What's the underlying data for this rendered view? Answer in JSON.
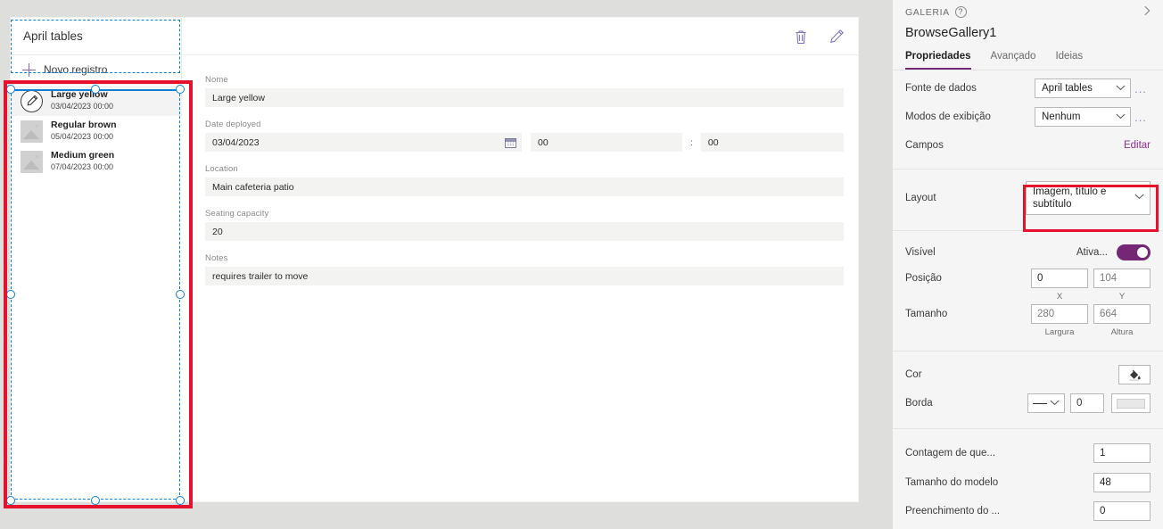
{
  "canvas": {
    "app_title": "April tables",
    "new_record_label": "Novo registro",
    "gallery_items": [
      {
        "title": "Large yellow",
        "subtitle": "03/04/2023 00:00",
        "thumb": "pencil-circle-icon",
        "selected": true
      },
      {
        "title": "Regular brown",
        "subtitle": "05/04/2023 00:00",
        "thumb": "image-placeholder-icon",
        "selected": false
      },
      {
        "title": "Medium green",
        "subtitle": "07/04/2023 00:00",
        "thumb": "image-placeholder-icon",
        "selected": false
      }
    ],
    "toolbar": {
      "delete_icon": "trash-icon",
      "edit_icon": "pencil-icon"
    },
    "form": {
      "fields": [
        {
          "label": "Nome",
          "value": "Large yellow"
        },
        {
          "label": "Location",
          "value": "Main cafeteria patio"
        },
        {
          "label": "Seating capacity",
          "value": "20"
        },
        {
          "label": "Notes",
          "value": "requires trailer to move"
        }
      ],
      "date_field": {
        "label": "Date deployed",
        "date": "03/04/2023",
        "calendar_icon": "calendar-icon",
        "hours": "00",
        "separator": ":",
        "minutes": "00"
      }
    }
  },
  "properties": {
    "kind": "GALERIA",
    "help_icon": "question-circle-icon",
    "collapse_icon": "chevron-right-icon",
    "control_name": "BrowseGallery1",
    "tabs": [
      {
        "label": "Propriedades",
        "active": true
      },
      {
        "label": "Avançado",
        "active": false
      },
      {
        "label": "Ideias",
        "active": false
      }
    ],
    "data_source": {
      "label": "Fonte de dados",
      "value": "April tables",
      "more": "..."
    },
    "display_modes": {
      "label": "Modos de exibição",
      "value": "Nenhum",
      "more": "..."
    },
    "fields": {
      "label": "Campos",
      "action": "Editar"
    },
    "layout": {
      "label": "Layout",
      "value": "Imagem, título e subtítulo",
      "highlight_color": "#e8112d"
    },
    "visible": {
      "label": "Visível",
      "state": "Ativa...",
      "on": true,
      "accent": "#742774"
    },
    "position": {
      "label": "Posição",
      "x": "0",
      "y": "104",
      "x_caption": "X",
      "y_caption": "Y"
    },
    "size": {
      "label": "Tamanho",
      "width": "280",
      "height": "664",
      "width_caption": "Largura",
      "height_caption": "Altura"
    },
    "color": {
      "label": "Cor",
      "icon": "fill-bucket-icon"
    },
    "border": {
      "label": "Borda",
      "style": "—",
      "thickness": "0",
      "color_icon": "border-color-swatch"
    },
    "wrap_count": {
      "label": "Contagem de que...",
      "value": "1"
    },
    "template_size": {
      "label": "Tamanho do modelo",
      "value": "48"
    },
    "template_padding": {
      "label": "Preenchimento do ...",
      "value": "0"
    }
  }
}
